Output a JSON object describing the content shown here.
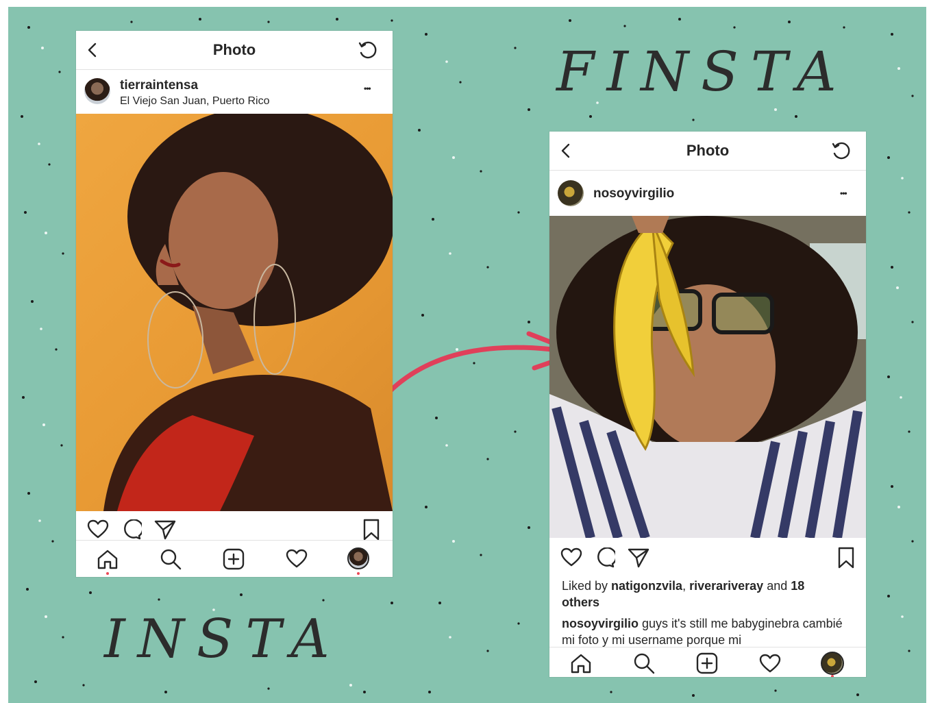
{
  "insta": {
    "header_title": "Photo",
    "username": "tierraintensa",
    "location": "El Viejo San Juan, Puerto Rico",
    "more_label": "•••"
  },
  "finsta": {
    "header_title": "Photo",
    "username": "nosoyvirgilio",
    "more_label": "•••",
    "likes_prefix": "Liked by ",
    "liker1": "natigonzvila",
    "likes_sep": ", ",
    "liker2": "riverariveray",
    "likes_and": " and ",
    "likes_count": "18",
    "likes_suffix": "others",
    "caption_user": "nosoyvirgilio",
    "caption_text": " guys it's still me babyginebra cambié mi foto y mi username porque mi"
  },
  "labels": {
    "finsta": "FINSTA",
    "insta": "INSTA"
  },
  "icons": {
    "back": "chevron-left-icon",
    "refresh": "refresh-icon",
    "like": "heart-icon",
    "comment": "comment-icon",
    "share": "send-icon",
    "save": "bookmark-icon",
    "home": "home-icon",
    "search": "search-icon",
    "add": "add-icon",
    "activity": "heart-icon",
    "profile": "avatar"
  },
  "colors": {
    "background": "#86c3af",
    "arrow": "#e0405a",
    "notification_dot": "#ed4956"
  }
}
